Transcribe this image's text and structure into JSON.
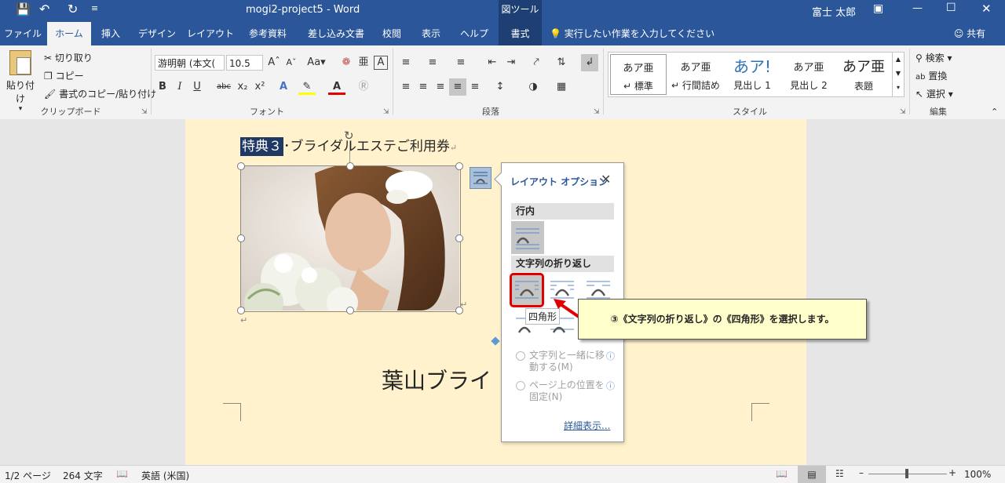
{
  "titlebar": {
    "doc_title": "mogi2-project5 - Word",
    "context_label": "図ツール",
    "user": "富士 太郎"
  },
  "tabs": [
    "ファイル",
    "ホーム",
    "挿入",
    "デザイン",
    "レイアウト",
    "参考資料",
    "差し込み文書",
    "校閲",
    "表示",
    "ヘルプ",
    "書式"
  ],
  "tell_me": "実行したい作業を入力してください",
  "share": "共有",
  "ribbon": {
    "clipboard": {
      "paste": "貼り付け",
      "cut": "切り取り",
      "copy": "コピー",
      "format_painter": "書式のコピー/貼り付け",
      "label": "クリップボード"
    },
    "font": {
      "name": "游明朝 (本文(",
      "size": "10.5",
      "label": "フォント"
    },
    "paragraph": {
      "label": "段落"
    },
    "styles": {
      "items": [
        {
          "preview": "あア亜",
          "name": "標準"
        },
        {
          "preview": "あア亜",
          "name": "行間詰め"
        },
        {
          "preview": "あア!",
          "name": "見出し 1"
        },
        {
          "preview": "あア亜",
          "name": "見出し 2"
        },
        {
          "preview": "あア亜",
          "name": "表題"
        }
      ],
      "label": "スタイル"
    },
    "editing": {
      "find": "検索",
      "replace": "置換",
      "select": "選択",
      "label": "編集"
    }
  },
  "document": {
    "heading_highlight": "特典３",
    "heading_rest": "･ブライダルエステご利用券",
    "big_text": "葉山ブライ"
  },
  "layout_panel": {
    "title": "レイアウト オプション",
    "inline_header": "行内",
    "wrap_header": "文字列の折り返し",
    "tooltip": "四角形",
    "move_with_text": "文字列と一緒に移動する(M)",
    "fix_position": "ページ上の位置を固定(N)",
    "more": "詳細表示..."
  },
  "callout": "③《文字列の折り返し》の《四角形》を選択します。",
  "status": {
    "page": "1/2 ページ",
    "words": "264 文字",
    "language": "英語 (米国)",
    "zoom": "100%"
  }
}
